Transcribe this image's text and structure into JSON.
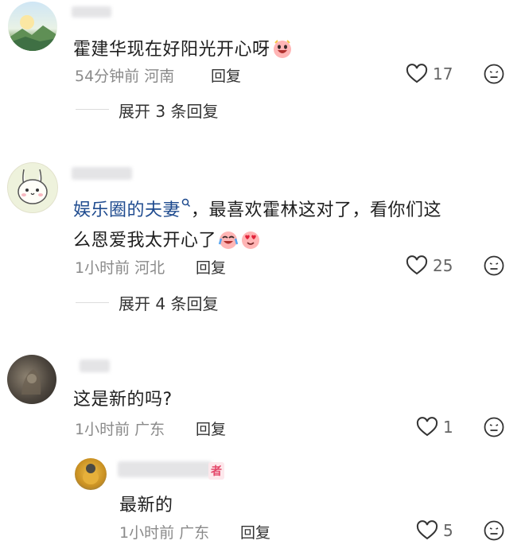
{
  "comments": [
    {
      "text": "霍建华现在好阳光开心呀",
      "time": "54分钟前",
      "location": "河南",
      "reply_label": "回复",
      "likes": "17",
      "expand": "展开 3 条回复"
    },
    {
      "link_text": "娱乐圈的夫妻",
      "text_after_link": "，最喜欢霍林这对了，看你们这",
      "text_line2": "么恩爱我太开心了",
      "time": "1小时前",
      "location": "河北",
      "reply_label": "回复",
      "likes": "25",
      "expand": "展开 4 条回复"
    },
    {
      "text": "这是新的吗?",
      "time": "1小时前",
      "location": "广东",
      "reply_label": "回复",
      "likes": "1"
    }
  ],
  "reply": {
    "author_badge": "者",
    "text": "最新的",
    "time": "1小时前",
    "location": "广东",
    "reply_label": "回复",
    "likes": "5"
  },
  "icons": {
    "like": "heart-outline-icon",
    "dislike": "frown-face-icon",
    "search_link": "search-icon"
  },
  "colors": {
    "link": "#1f4b8f",
    "meta": "#8a8a8a",
    "author_badge": "#e4486a"
  }
}
